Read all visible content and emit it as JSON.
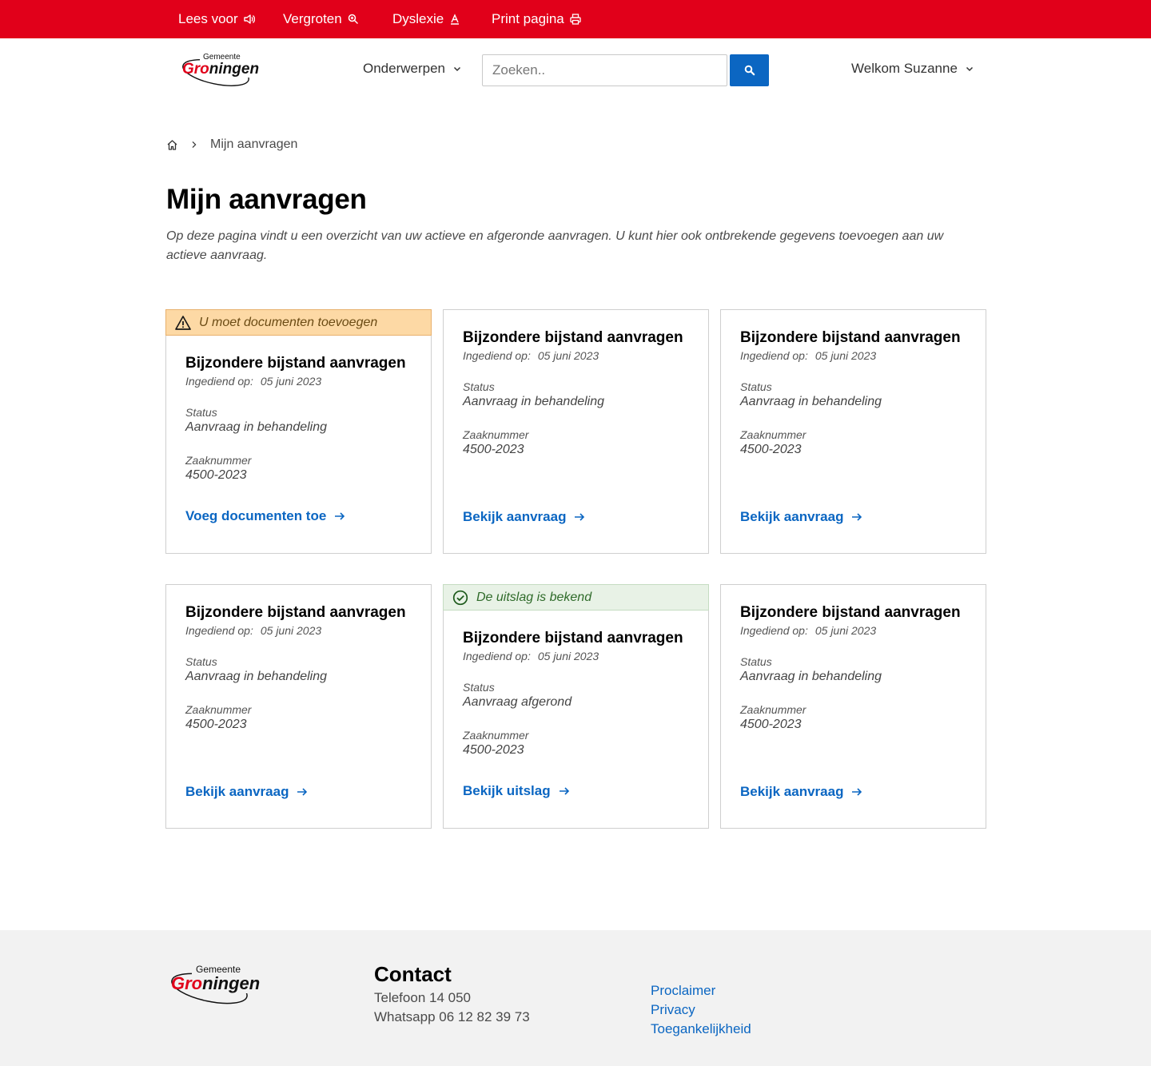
{
  "topbar": {
    "read_aloud": "Lees voor",
    "enlarge": "Vergroten",
    "dyslexia": "Dyslexie",
    "print": "Print pagina"
  },
  "header": {
    "logo_small": "Gemeente",
    "logo_big": "Groningen",
    "nav_subjects": "Onderwerpen",
    "search_placeholder": "Zoeken..",
    "welcome": "Welkom Suzanne"
  },
  "breadcrumb": {
    "current": "Mijn aanvragen"
  },
  "page": {
    "title": "Mijn aanvragen",
    "intro": "Op deze pagina vindt u een overzicht van uw actieve en afgeronde aanvragen. U kunt hier ook ontbrekende gegevens toevoegen aan uw actieve aanvraag."
  },
  "cards": [
    {
      "banner": "U moet documenten toevoegen",
      "title": "Bijzondere bijstand aanvragen",
      "submitted_label": "Ingediend op:",
      "submitted_date": "05 juni 2023",
      "status_label": "Status",
      "status_value": "Aanvraag in behandeling",
      "case_label": "Zaaknummer",
      "case_value": "4500-2023",
      "link": "Voeg documenten toe"
    },
    {
      "title": "Bijzondere bijstand aanvragen",
      "submitted_label": "Ingediend op:",
      "submitted_date": "05 juni 2023",
      "status_label": "Status",
      "status_value": "Aanvraag in behandeling",
      "case_label": "Zaaknummer",
      "case_value": "4500-2023",
      "link": "Bekijk aanvraag"
    },
    {
      "title": "Bijzondere bijstand aanvragen",
      "submitted_label": "Ingediend op:",
      "submitted_date": "05 juni 2023",
      "status_label": "Status",
      "status_value": "Aanvraag in behandeling",
      "case_label": "Zaaknummer",
      "case_value": "4500-2023",
      "link": "Bekijk aanvraag"
    },
    {
      "title": "Bijzondere bijstand aanvragen",
      "submitted_label": "Ingediend op:",
      "submitted_date": "05 juni 2023",
      "status_label": "Status",
      "status_value": "Aanvraag in behandeling",
      "case_label": "Zaaknummer",
      "case_value": "4500-2023",
      "link": "Bekijk aanvraag"
    },
    {
      "banner": "De uitslag is bekend",
      "title": "Bijzondere bijstand aanvragen",
      "submitted_label": "Ingediend op:",
      "submitted_date": "05 juni 2023",
      "status_label": "Status",
      "status_value": "Aanvraag afgerond",
      "case_label": "Zaaknummer",
      "case_value": "4500-2023",
      "link": "Bekijk uitslag"
    },
    {
      "title": "Bijzondere bijstand aanvragen",
      "submitted_label": "Ingediend op:",
      "submitted_date": "05 juni 2023",
      "status_label": "Status",
      "status_value": "Aanvraag in behandeling",
      "case_label": "Zaaknummer",
      "case_value": "4500-2023",
      "link": "Bekijk aanvraag"
    }
  ],
  "footer": {
    "contact_title": "Contact",
    "phone": "Telefoon 14 050",
    "whatsapp": "Whatsapp 06 12 82 39 73",
    "links": [
      "Proclaimer",
      "Privacy",
      "Toegankelijkheid"
    ]
  },
  "colors": {
    "brand_red": "#e1001a",
    "link_blue": "#0b66c2",
    "warning_bg": "#fdd9a5",
    "success_bg": "#e8f2e6",
    "footer_bg": "#f2f2f2"
  }
}
